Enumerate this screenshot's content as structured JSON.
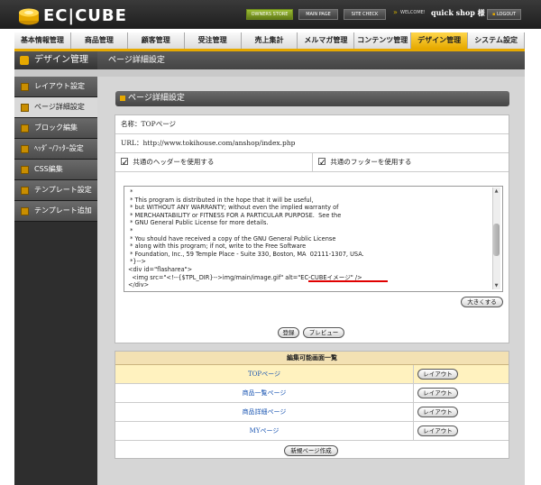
{
  "brand": {
    "logo_text": "EC|CUBE"
  },
  "header": {
    "owners_store": "OWNERS STORE",
    "main_page": "MAIN PAGE",
    "site_check": "SITE CHECK",
    "welcome": "WELCOME!",
    "shop_name": "quick shop 様",
    "logout": "LOGOUT"
  },
  "nav": [
    "基本情報管理",
    "商品管理",
    "顧客管理",
    "受注管理",
    "売上集計",
    "メルマガ管理",
    "コンテンツ管理",
    "デザイン管理",
    "システム設定"
  ],
  "nav_active_index": 7,
  "section_title": "デザイン管理",
  "page_subtitle": "ページ詳細設定",
  "sidebar": [
    {
      "label": "レイアウト設定",
      "active": false
    },
    {
      "label": "ページ詳細設定",
      "active": true
    },
    {
      "label": "ブロック編集",
      "active": false
    },
    {
      "label": "ﾍｯﾀﾞｰ/ﾌｯﾀｰ設定",
      "active": false
    },
    {
      "label": "CSS編集",
      "active": false
    },
    {
      "label": "テンプレート設定",
      "active": false
    },
    {
      "label": "テンプレート追加",
      "active": false
    }
  ],
  "panel": {
    "title": "ページ詳細設定",
    "name_label": "名称：TOPページ",
    "url_label": "URL：http://www.tokihouse.com/anshop/index.php",
    "use_header_label": "共通のヘッダーを使用する",
    "use_header_checked": true,
    "use_footer_label": "共通のフッターを使用する",
    "use_footer_checked": true
  },
  "editor_lines": [
    " *",
    " * This program is distributed in the hope that it will be useful,",
    " * but WITHOUT ANY WARRANTY; without even the implied warranty of",
    " * MERCHANTABILITY or FITNESS FOR A PARTICULAR PURPOSE.  See the",
    " * GNU General Public License for more details.",
    " *",
    " * You should have received a copy of the GNU General Public License",
    " * along with this program; if not, write to the Free Software",
    " * Foundation, Inc., 59 Temple Place - Suite 330, Boston, MA  02111-1307, USA.",
    " *}-->",
    "<div id=\"flasharea\">",
    "  <img src=\"<!--{$TPL_DIR}-->img/main/image.gif\" alt=\"EC-CUBEイメージ\" />",
    "</div>"
  ],
  "buttons": {
    "enlarge": "大きくする",
    "register": "登録",
    "preview": "プレビュー",
    "new_page": "新規ページ作成"
  },
  "page_list": {
    "header": "編集可能画面一覧",
    "layout_label": "レイアウト",
    "rows": [
      {
        "name": "TOPページ",
        "highlighted": true
      },
      {
        "name": "商品一覧ページ",
        "highlighted": false
      },
      {
        "name": "商品詳細ページ",
        "highlighted": false
      },
      {
        "name": "MYページ",
        "highlighted": false
      }
    ]
  },
  "colors": {
    "accent_gold": "#e6a900",
    "header_dark": "#2b2b2b",
    "link_blue": "#1c57b3",
    "highlight_row": "#fff2bf",
    "underline_red": "#e00000"
  }
}
